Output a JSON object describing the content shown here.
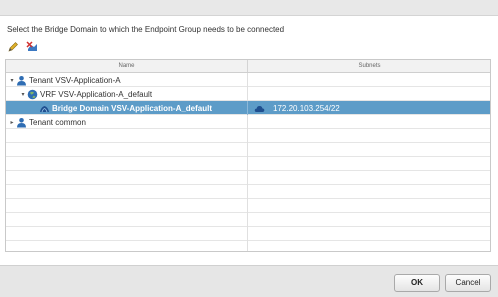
{
  "dialog": {
    "instruction": "Select the Bridge Domain to which the Endpoint Group needs to be connected"
  },
  "grid": {
    "columns": [
      "Name",
      "Subnets"
    ],
    "rows": [
      {
        "label": "Tenant VSV-Application-A",
        "subnet": "",
        "expander": "▾",
        "icon": "tenant-icon"
      },
      {
        "label": "VRF VSV-Application-A_default",
        "subnet": "",
        "expander": "▾",
        "icon": "vrf-globe-icon"
      },
      {
        "label": "Bridge Domain VSV-Application-A_default",
        "subnet": "172.20.103.254/22",
        "expander": "",
        "icon": "bridge-domain-icon",
        "selected": true
      },
      {
        "label": "Tenant common",
        "subnet": "",
        "expander": "▸",
        "icon": "tenant-icon"
      }
    ]
  },
  "footer": {
    "ok_label": "OK",
    "cancel_label": "Cancel"
  },
  "colors": {
    "selection": "#5d9cc8",
    "accent_icon": "#2f6db3"
  }
}
